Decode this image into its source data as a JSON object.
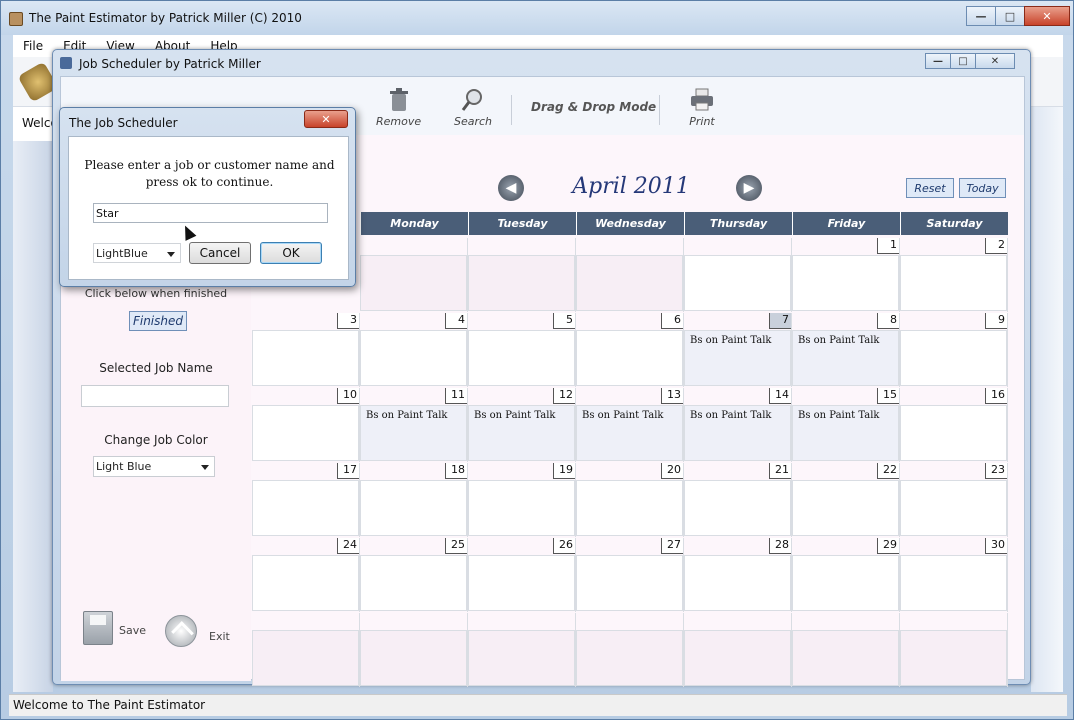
{
  "app": {
    "title": "The Paint Estimator by Patrick Miller (C) 2010",
    "menu": [
      "File",
      "Edit",
      "View",
      "About",
      "Help"
    ],
    "welcome": "Welco",
    "status": "Welcome to The Paint Estimator",
    "window_buttons": {
      "minimize": "—",
      "maximize": "□",
      "close": "✕"
    }
  },
  "scheduler": {
    "title": "Job Scheduler by Patrick Miller",
    "toolbar": {
      "remove": "Remove",
      "search": "Search",
      "drag_drop": "Drag & Drop Mode",
      "print": "Print"
    },
    "left_panel": {
      "click_below": "Click below when finished",
      "finished": "Finished",
      "selected_job_label": "Selected Job Name",
      "selected_job_value": "",
      "change_color_label": "Change Job Color",
      "color_value": "Light Blue",
      "save": "Save",
      "exit": "Exit"
    },
    "calendar": {
      "month": "April 2011",
      "reset": "Reset",
      "today": "Today",
      "prev": "◀",
      "next": "▶",
      "days": [
        "Monday",
        "Tuesday",
        "Wednesday",
        "Thursday",
        "Friday",
        "Saturday"
      ],
      "weeks": [
        [
          {
            "d": "",
            "e": ""
          },
          {
            "d": "",
            "e": ""
          },
          {
            "d": "",
            "e": ""
          },
          {
            "d": "",
            "e": ""
          },
          {
            "d": "1",
            "e": ""
          },
          {
            "d": "2",
            "e": ""
          }
        ],
        [
          {
            "d": "3",
            "e": ""
          },
          {
            "d": "4",
            "e": ""
          },
          {
            "d": "5",
            "e": ""
          },
          {
            "d": "6",
            "e": ""
          },
          {
            "d": "7",
            "e": "Bs on Paint Talk"
          },
          {
            "d": "8",
            "e": "Bs on Paint Talk"
          },
          {
            "d": "9",
            "e": ""
          }
        ],
        [
          {
            "d": "10",
            "e": ""
          },
          {
            "d": "11",
            "e": "Bs on Paint Talk"
          },
          {
            "d": "12",
            "e": "Bs on Paint Talk"
          },
          {
            "d": "13",
            "e": "Bs on Paint Talk"
          },
          {
            "d": "14",
            "e": "Bs on Paint Talk"
          },
          {
            "d": "15",
            "e": "Bs on Paint Talk"
          },
          {
            "d": "16",
            "e": ""
          }
        ],
        [
          {
            "d": "17",
            "e": ""
          },
          {
            "d": "18",
            "e": ""
          },
          {
            "d": "19",
            "e": ""
          },
          {
            "d": "20",
            "e": ""
          },
          {
            "d": "21",
            "e": ""
          },
          {
            "d": "22",
            "e": ""
          },
          {
            "d": "23",
            "e": ""
          }
        ],
        [
          {
            "d": "24",
            "e": ""
          },
          {
            "d": "25",
            "e": ""
          },
          {
            "d": "26",
            "e": ""
          },
          {
            "d": "27",
            "e": ""
          },
          {
            "d": "28",
            "e": ""
          },
          {
            "d": "29",
            "e": ""
          },
          {
            "d": "30",
            "e": ""
          }
        ]
      ]
    }
  },
  "dialog": {
    "title": "The Job Scheduler",
    "close": "✕",
    "message_line1": "Please enter a job or customer name  and",
    "message_line2": "press ok to continue.",
    "input_value": "Star",
    "color_value": "LightBlue",
    "cancel": "Cancel",
    "ok": "OK"
  }
}
